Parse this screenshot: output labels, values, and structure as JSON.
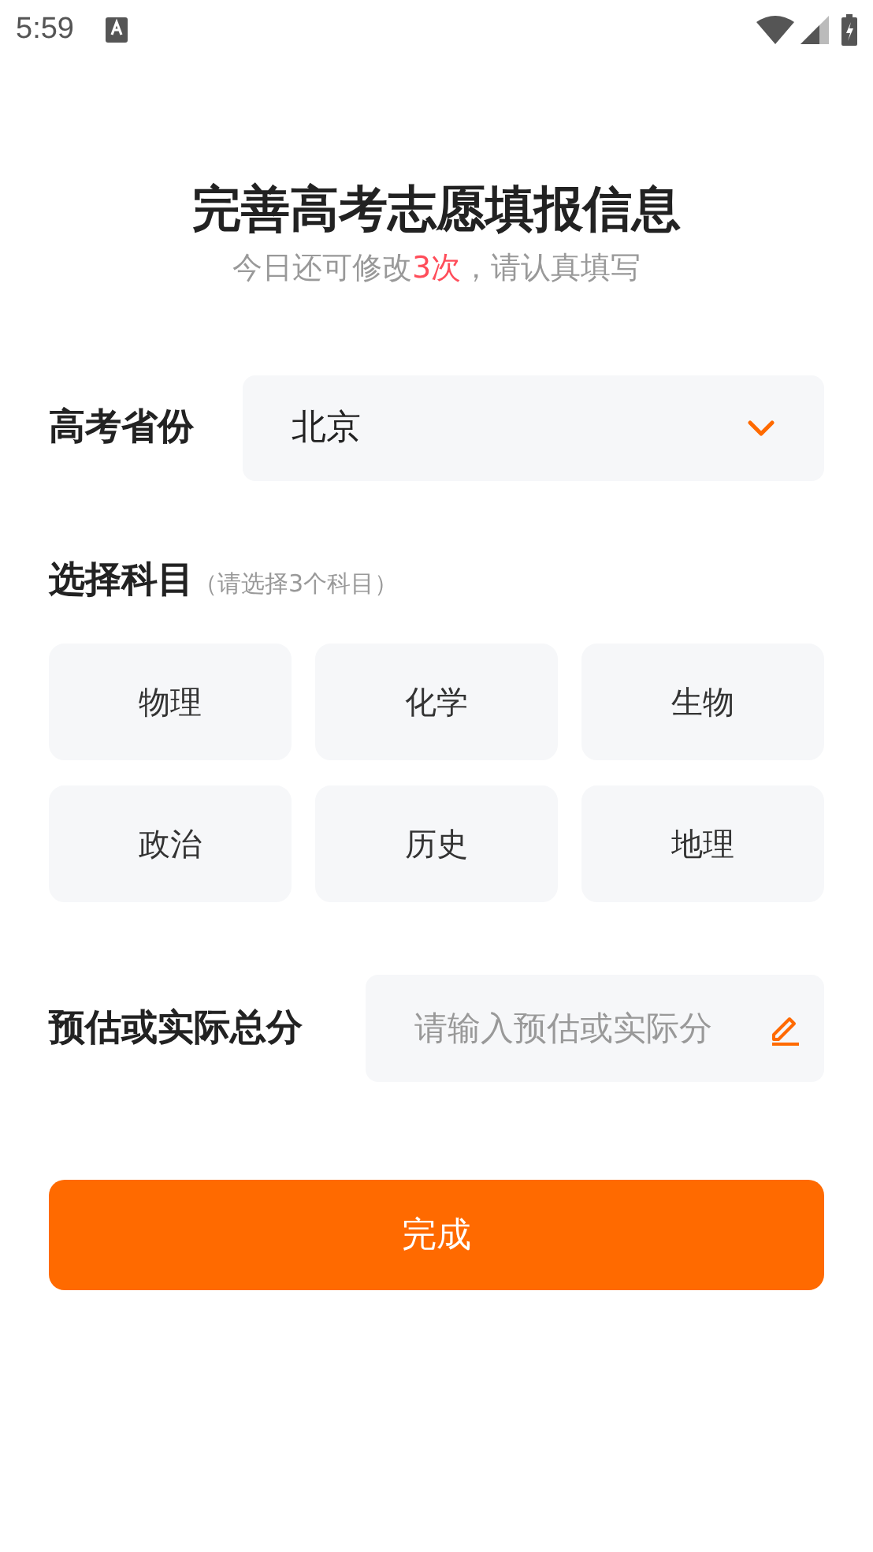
{
  "status_bar": {
    "time": "5:59"
  },
  "title": "完善高考志愿填报信息",
  "subtitle": "今日还可修改**3次**，请认真填写",
  "province": {
    "label": "高考省份",
    "value": "北京"
  },
  "subjects": {
    "title": "选择科目",
    "hint": "（请选择3个科目）",
    "items": [
      {
        "label": "物理",
        "selected": false
      },
      {
        "label": "化学",
        "selected": false
      },
      {
        "label": "生物",
        "selected": false
      },
      {
        "label": "政治",
        "selected": false
      },
      {
        "label": "历史",
        "selected": false
      },
      {
        "label": "地理",
        "selected": false
      }
    ]
  },
  "score": {
    "label": "预估或实际总分",
    "placeholder": "请输入预估或实际分"
  },
  "submit": "完成"
}
